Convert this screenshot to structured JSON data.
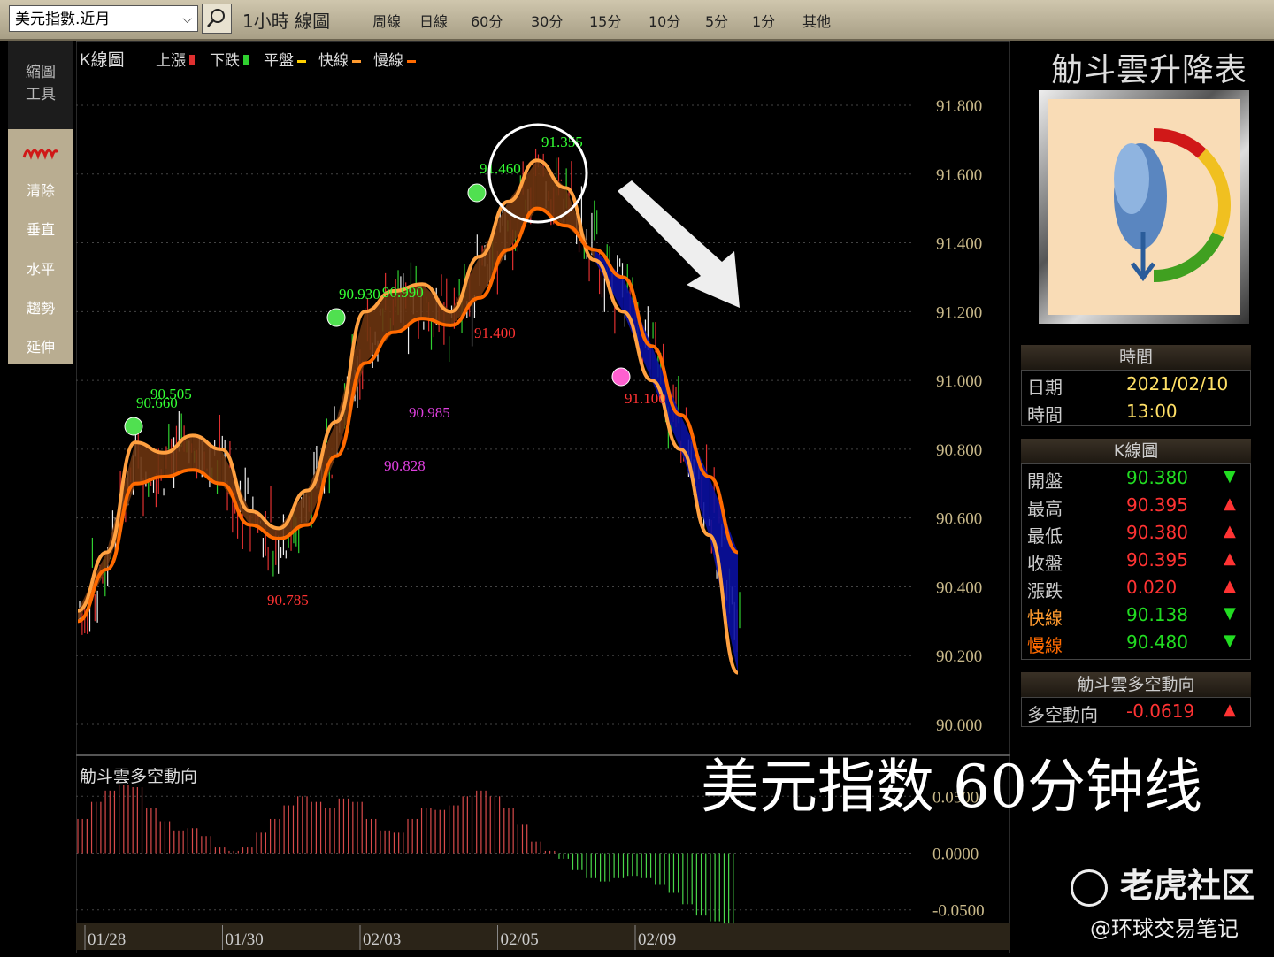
{
  "toolbar": {
    "symbol": "美元指數.近月",
    "period_label": "1小時 線圖",
    "tabs": [
      "周線",
      "日線",
      "60分",
      "30分",
      "15分",
      "10分",
      "5分",
      "1分",
      "其他"
    ]
  },
  "tools": {
    "head_line1": "縮圖",
    "head_line2": "工具",
    "items": [
      "清除",
      "垂直",
      "水平",
      "趨勢",
      "延伸"
    ]
  },
  "legend": {
    "title": "K線圖",
    "items": [
      {
        "label": "上漲",
        "color": "#e03030"
      },
      {
        "label": "下跌",
        "color": "#30d030"
      },
      {
        "label": "平盤",
        "color": "#ffd000"
      },
      {
        "label": "快線",
        "color": "#ff9a2e"
      },
      {
        "label": "慢線",
        "color": "#ff6a00"
      }
    ]
  },
  "chart_data": [
    {
      "type": "line",
      "title": "K線圖",
      "x_ticks": [
        "01/28",
        "01/30",
        "02/03",
        "02/05",
        "02/09"
      ],
      "y_ticks": [
        "91.800",
        "91.600",
        "91.400",
        "91.200",
        "91.000",
        "90.800",
        "90.600",
        "90.400",
        "90.200",
        "90.000"
      ],
      "ylim": [
        90.0,
        91.8
      ],
      "grid": true,
      "legend_position": "top-left",
      "series": [
        {
          "name": "快線",
          "color": "#ffa040",
          "values": [
            90.33,
            90.5,
            90.82,
            90.79,
            90.84,
            90.8,
            90.62,
            90.57,
            90.68,
            90.88,
            91.2,
            91.26,
            91.28,
            91.2,
            91.36,
            91.52,
            91.64,
            91.56,
            91.35,
            91.2,
            91.0,
            90.8,
            90.55,
            90.15
          ]
        },
        {
          "name": "慢線",
          "color": "#ff6a00",
          "values": [
            90.3,
            90.45,
            90.7,
            90.72,
            90.74,
            90.7,
            90.58,
            90.54,
            90.58,
            90.78,
            91.05,
            91.14,
            91.18,
            91.16,
            91.24,
            91.38,
            91.5,
            91.45,
            91.38,
            91.3,
            91.1,
            90.9,
            90.72,
            90.5
          ]
        }
      ],
      "annotations": [
        {
          "text": "90.660",
          "color": "#33ff33"
        },
        {
          "text": "90.505",
          "color": "#33ff33"
        },
        {
          "text": "90.785",
          "color": "#ff3333"
        },
        {
          "text": "90.930",
          "color": "#33ff33"
        },
        {
          "text": "90.990",
          "color": "#33ff33"
        },
        {
          "text": "90.985",
          "color": "#e040e0"
        },
        {
          "text": "90.828",
          "color": "#e040e0"
        },
        {
          "text": "91.460",
          "color": "#33ff33"
        },
        {
          "text": "91.355",
          "color": "#33ff33"
        },
        {
          "text": "91.400",
          "color": "#ff3333"
        },
        {
          "text": "91.100",
          "color": "#ff3333"
        }
      ]
    },
    {
      "type": "bar",
      "title": "觔斗雲多空動向",
      "y_ticks": [
        "0.0500",
        "0.0000",
        "-0.0500"
      ],
      "ylim": [
        -0.065,
        0.065
      ],
      "values": [
        0.03,
        0.045,
        0.055,
        0.06,
        0.058,
        0.04,
        0.028,
        0.02,
        0.022,
        0.015,
        0.005,
        0.002,
        0.005,
        0.018,
        0.03,
        0.042,
        0.05,
        0.045,
        0.04,
        0.048,
        0.045,
        0.03,
        0.02,
        0.018,
        0.03,
        0.04,
        0.038,
        0.042,
        0.05,
        0.055,
        0.05,
        0.04,
        0.025,
        0.01,
        0.002,
        -0.005,
        -0.015,
        -0.022,
        -0.025,
        -0.022,
        -0.02,
        -0.022,
        -0.028,
        -0.035,
        -0.045,
        -0.055,
        -0.06,
        -0.062
      ]
    }
  ],
  "right_panel": {
    "title": "觔斗雲升降表",
    "time_header": "時間",
    "date_label": "日期",
    "date_value": "2021/02/10",
    "time_label": "時間",
    "time_value": "13:00",
    "kline_header": "K線圖",
    "rows": [
      {
        "label": "開盤",
        "value": "90.380",
        "arrow": "▼",
        "color": "#22dd22",
        "label_color": "#cccccc"
      },
      {
        "label": "最高",
        "value": "90.395",
        "arrow": "▲",
        "color": "#ff3333",
        "label_color": "#cccccc"
      },
      {
        "label": "最低",
        "value": "90.380",
        "arrow": "▲",
        "color": "#ff3333",
        "label_color": "#cccccc"
      },
      {
        "label": "收盤",
        "value": "90.395",
        "arrow": "▲",
        "color": "#ff3333",
        "label_color": "#cccccc"
      },
      {
        "label": "漲跌",
        "value": "0.020",
        "arrow": "▲",
        "color": "#ff3333",
        "label_color": "#cccccc"
      },
      {
        "label": "快線",
        "value": "90.138",
        "arrow": "▼",
        "color": "#22dd22",
        "label_color": "#ff9a2e"
      },
      {
        "label": "慢線",
        "value": "90.480",
        "arrow": "▼",
        "color": "#22dd22",
        "label_color": "#ff6a00"
      }
    ],
    "direction_header": "觔斗雲多空動向",
    "direction_label": "多空動向",
    "direction_value": "-0.0619",
    "direction_arrow": "▲"
  },
  "overlay_caption": "美元指数 60分钟线",
  "watermark": {
    "brand": "老虎社区",
    "handle": "@环球交易笔记"
  }
}
